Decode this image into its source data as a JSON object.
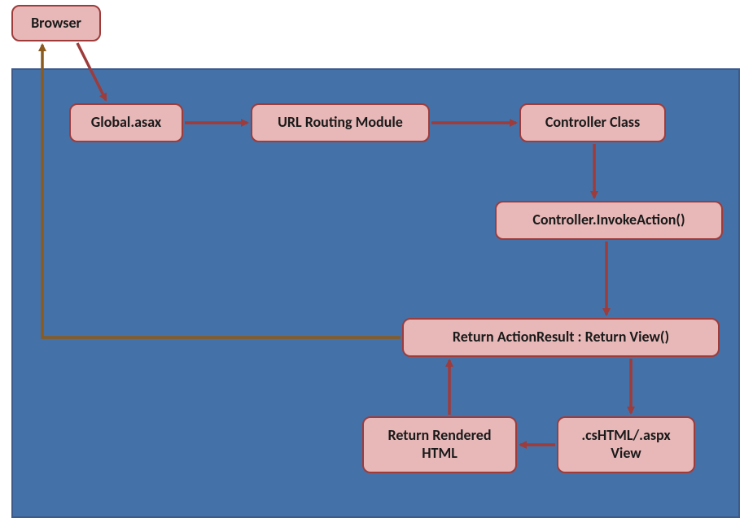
{
  "nodes": {
    "browser": "Browser",
    "global_asax": "Global.asax",
    "url_routing": "URL Routing Module",
    "controller_class": "Controller Class",
    "invoke_action": "Controller.InvokeAction()",
    "return_actionresult": "Return ActionResult : Return View()",
    "cshtml_view": ".csHTML/.aspx View",
    "return_rendered": "Return Rendered HTML"
  }
}
